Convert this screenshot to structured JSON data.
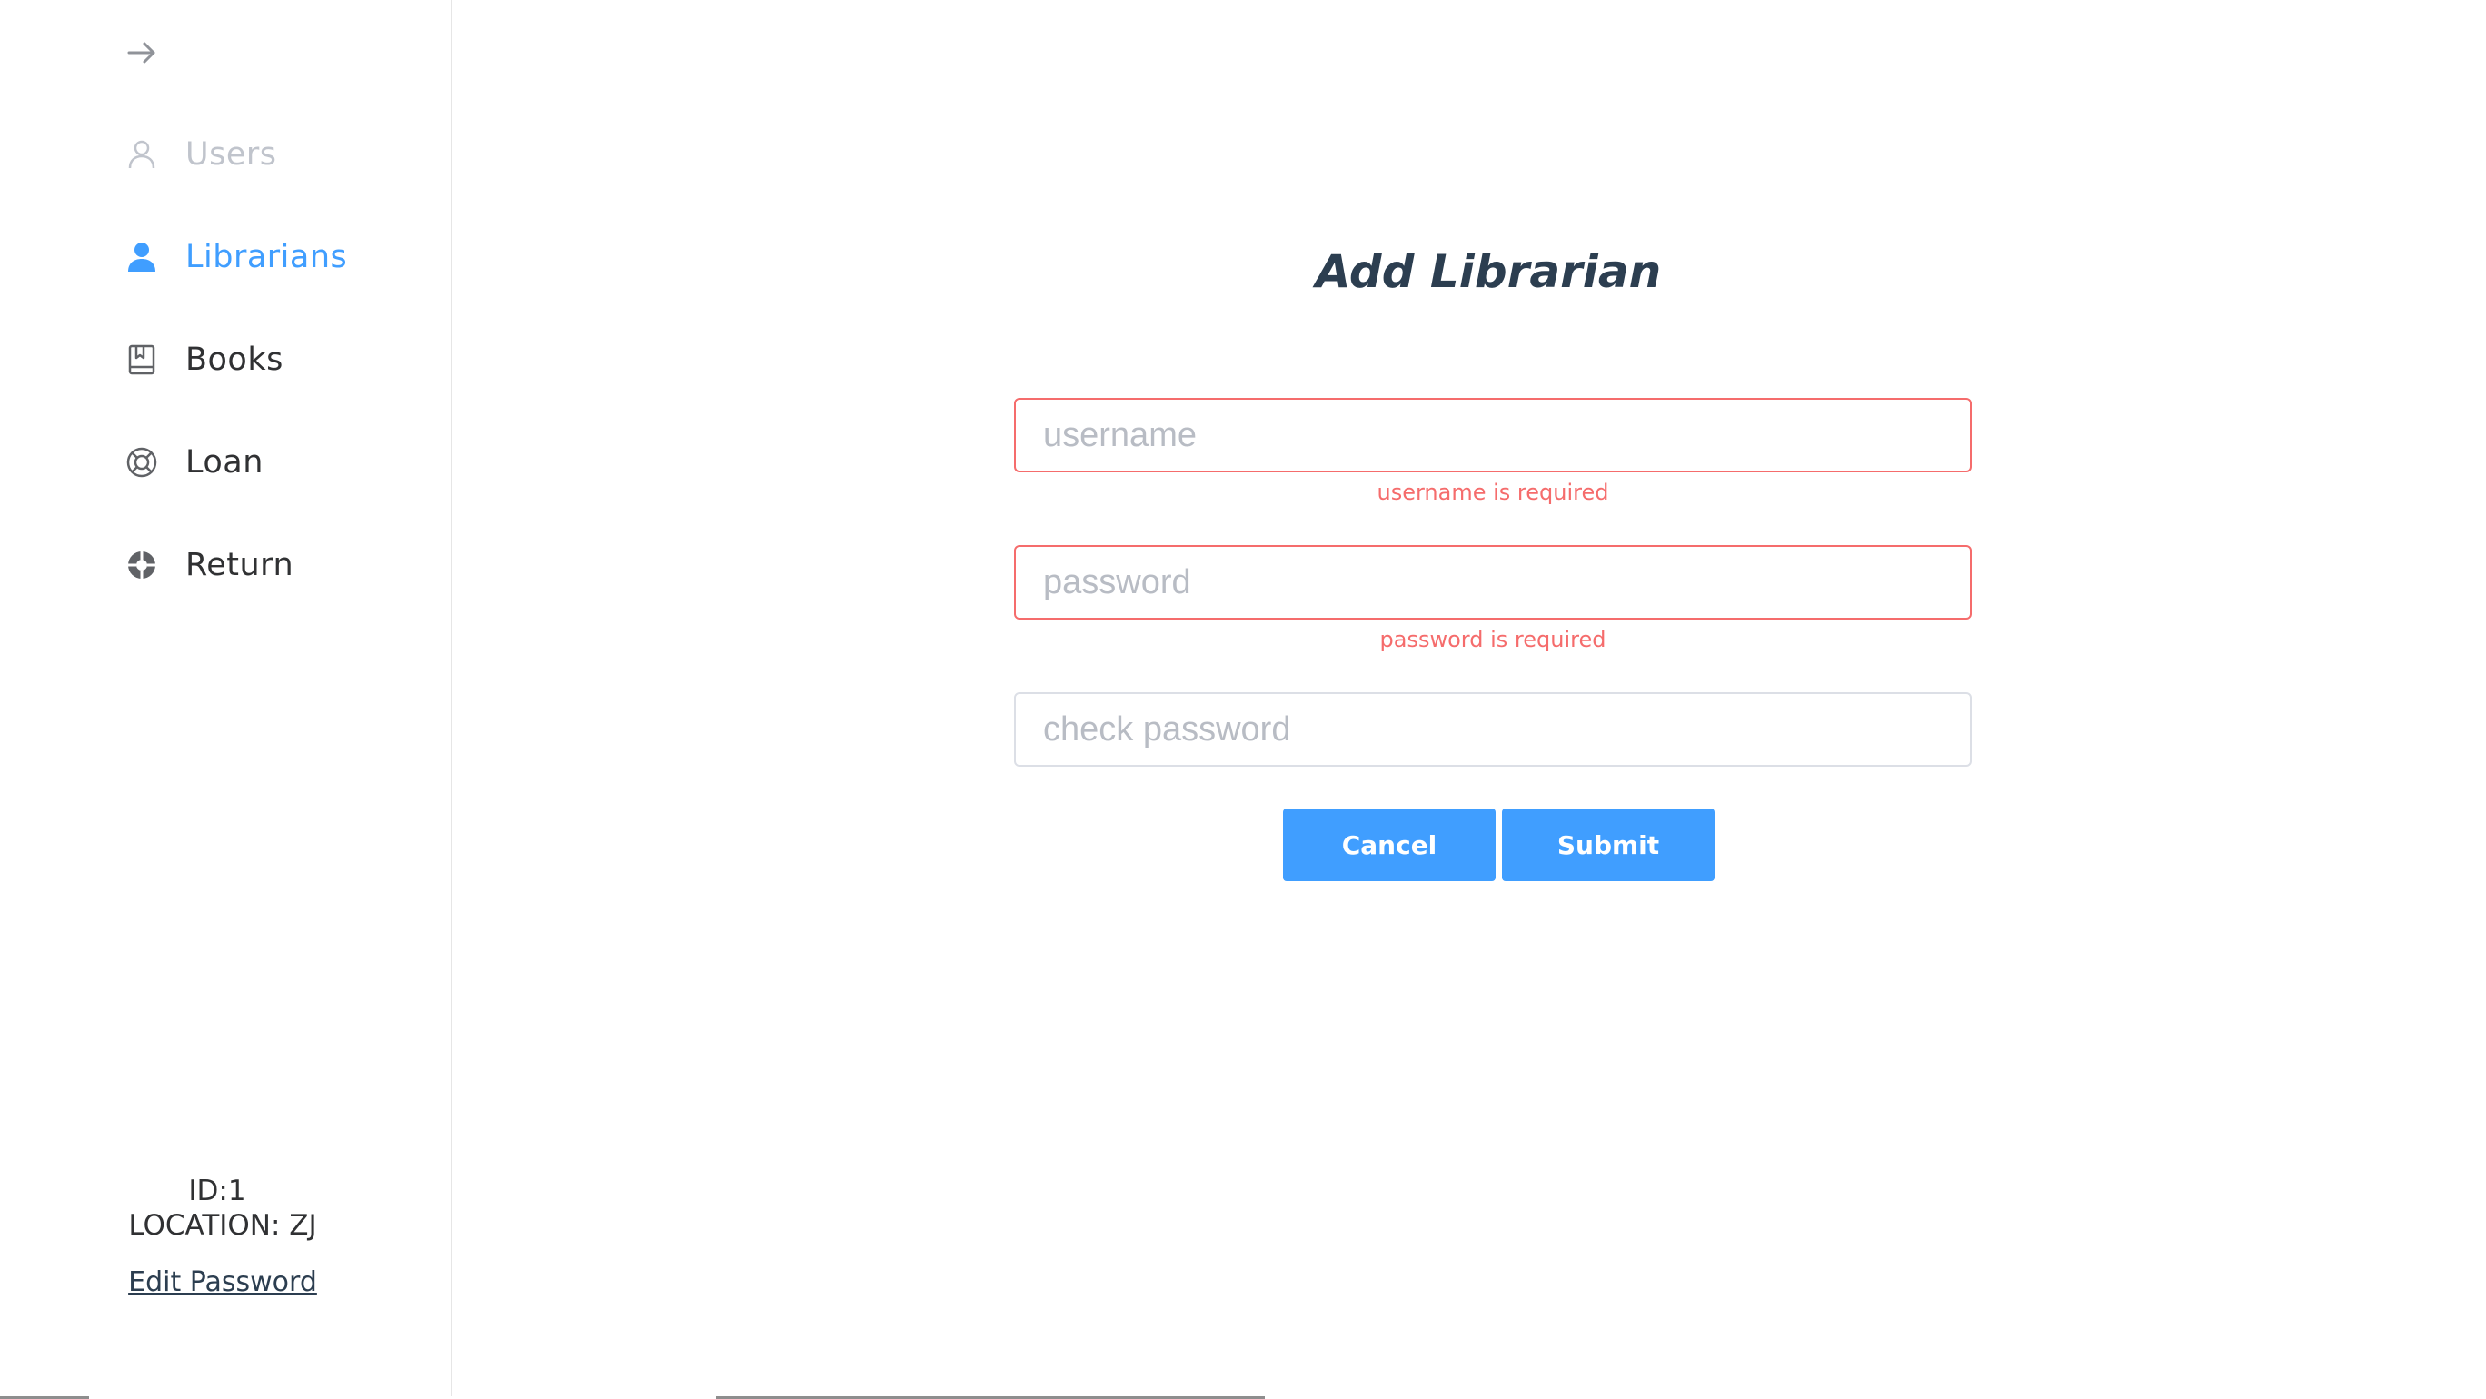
{
  "sidebar": {
    "collapse_icon": "arrow-right-icon",
    "items": [
      {
        "label": "Users",
        "icon": "user-outline-icon",
        "state": "disabled"
      },
      {
        "label": "Librarians",
        "icon": "user-filled-icon",
        "state": "active"
      },
      {
        "label": "Books",
        "icon": "book-icon",
        "state": "normal"
      },
      {
        "label": "Loan",
        "icon": "lifebuoy-icon",
        "state": "normal"
      },
      {
        "label": "Return",
        "icon": "return-icon",
        "state": "normal"
      }
    ],
    "user_id": "ID:1",
    "location": "LOCATION: ZJ",
    "edit_password": "Edit Password"
  },
  "form": {
    "title": "Add Librarian",
    "username": {
      "placeholder": "username",
      "value": "",
      "error": "username is required"
    },
    "password": {
      "placeholder": "password",
      "value": "",
      "error": "password is required"
    },
    "check_password": {
      "placeholder": "check password",
      "value": ""
    },
    "cancel_label": "Cancel",
    "submit_label": "Submit"
  },
  "colors": {
    "accent": "#409eff",
    "error": "#f56c6c",
    "title": "#2c3e50",
    "disabled": "#c0c4cc"
  }
}
